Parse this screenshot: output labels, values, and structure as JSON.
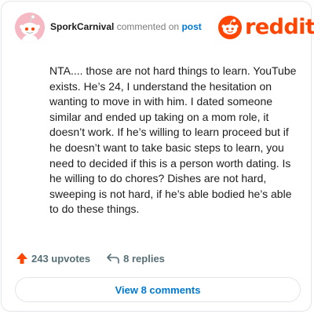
{
  "comment": {
    "author": "SporkCarnival",
    "action_text": "commented on",
    "target_text": "post",
    "body": "NTA.... those are not hard things to learn. YouTube exists. He’s 24, I understand the hesitation on wanting to move in with him. I dated someone similar and ended up taking on a mom role, it doesn’t work. If he’s willing to learn proceed but if he doesn’t want to take basic steps to learn, you need to decided if this is a person worth dating. Is he willing to do chores? Dishes are not hard, sweeping is not hard, if he’s able bodied he’s able to do these things."
  },
  "brand": {
    "wordmark": "reddit",
    "color": "#ff4500"
  },
  "stats": {
    "upvotes_label": "243 upvotes",
    "replies_label": "8 replies"
  },
  "footer": {
    "view_comments_label": "View 8 comments"
  },
  "icons": {
    "avatar": "snoo-avatar",
    "logo": "reddit-snoo-icon",
    "upvote": "upvote-arrow-icon",
    "reply": "reply-arrow-icon"
  },
  "colors": {
    "avatar_bg": "#f6b9c3",
    "link": "#0079d3",
    "muted": "#576f76"
  }
}
